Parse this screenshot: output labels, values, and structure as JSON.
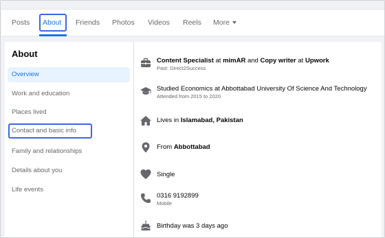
{
  "nav": {
    "tabs": [
      {
        "label": "Posts"
      },
      {
        "label": "About"
      },
      {
        "label": "Friends"
      },
      {
        "label": "Photos"
      },
      {
        "label": "Videos"
      },
      {
        "label": "Reels"
      },
      {
        "label": "More"
      }
    ]
  },
  "sidebar": {
    "title": "About",
    "items": [
      {
        "label": "Overview"
      },
      {
        "label": "Work and education"
      },
      {
        "label": "Places lived"
      },
      {
        "label": "Contact and basic info"
      },
      {
        "label": "Family and relationships"
      },
      {
        "label": "Details about you"
      },
      {
        "label": "Life events"
      }
    ]
  },
  "overview": {
    "work": {
      "title": "Content Specialist",
      "at1": " at ",
      "company": "mimAR",
      "and": " and ",
      "title2": "Copy writer",
      "at2": " at ",
      "company2": "Upwork",
      "sub": "Past: Direct2Success"
    },
    "education": {
      "text": "Studied Economics at Abbottabad University Of Science And Technology",
      "sub": "Attended from 2015 to 2020"
    },
    "lives": {
      "prefix": "Lives in ",
      "place": "Islamabad, Pakistan"
    },
    "from": {
      "prefix": "From ",
      "place": "Abbottabad"
    },
    "relationship": {
      "text": "Single"
    },
    "phone": {
      "number": "0316 9192899",
      "sub": "Mobile"
    },
    "birthday": {
      "text": "Birthday was 3 days ago"
    }
  },
  "colors": {
    "accent": "#1b74e4",
    "highlight": "#3b66e0",
    "icon": "#65676b"
  }
}
